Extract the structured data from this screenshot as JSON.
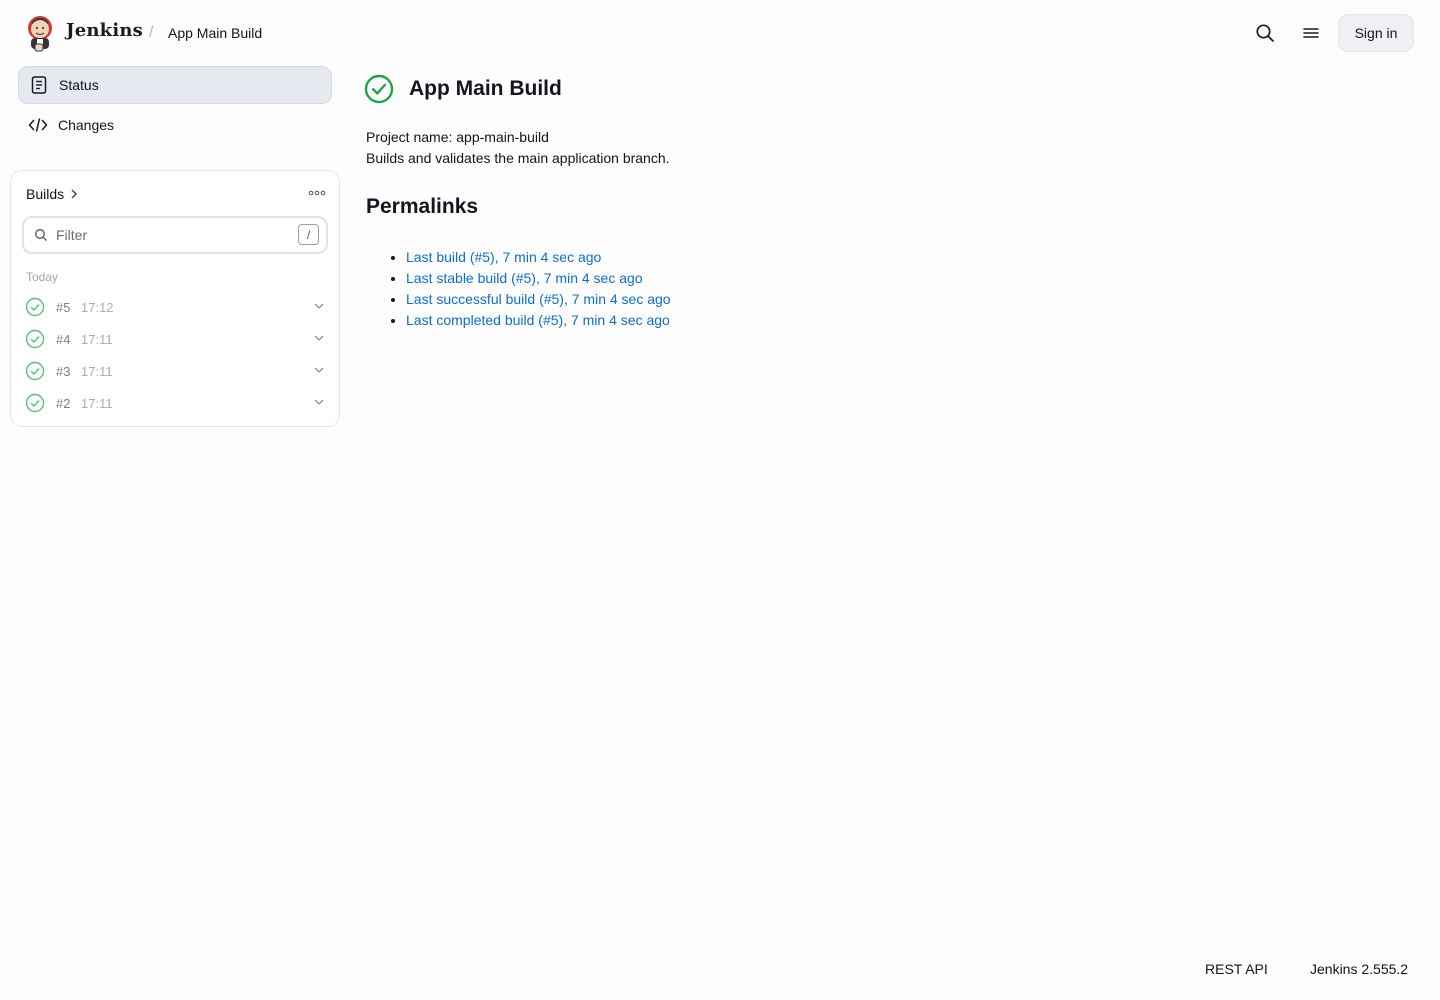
{
  "header": {
    "brand": "Jenkins",
    "breadcrumb_separator": "/",
    "breadcrumb_item": "App Main Build",
    "signin_label": "Sign in",
    "icons": [
      "jenkins-logo",
      "search-icon",
      "menu-icon"
    ]
  },
  "sidebar": {
    "items": [
      {
        "label": "Status",
        "icon": "document-icon",
        "active": true
      },
      {
        "label": "Changes",
        "icon": "code-icon",
        "active": false
      }
    ]
  },
  "builds": {
    "title": "Builds",
    "filter_placeholder": "Filter",
    "filter_shortcut": "/",
    "group_label": "Today",
    "rows": [
      {
        "number": "#5",
        "time": "17:12",
        "status": "success"
      },
      {
        "number": "#4",
        "time": "17:11",
        "status": "success"
      },
      {
        "number": "#3",
        "time": "17:11",
        "status": "success"
      },
      {
        "number": "#2",
        "time": "17:11",
        "status": "success"
      }
    ]
  },
  "main": {
    "title": "App Main Build",
    "status": "success",
    "project_name_line": "Project name: app-main-build",
    "description": "Builds and validates the main application branch.",
    "permalinks_title": "Permalinks",
    "permalinks": [
      "Last build (#5), 7 min 4 sec ago",
      "Last stable build (#5), 7 min 4 sec ago",
      "Last successful build (#5), 7 min 4 sec ago",
      "Last completed build (#5), 7 min 4 sec ago"
    ]
  },
  "footer": {
    "rest_api": "REST API",
    "version": "Jenkins 2.555.2"
  },
  "colors": {
    "success": "#1ea446",
    "link": "#0b6fcd",
    "active_nav_bg": "#e7e9f1"
  }
}
